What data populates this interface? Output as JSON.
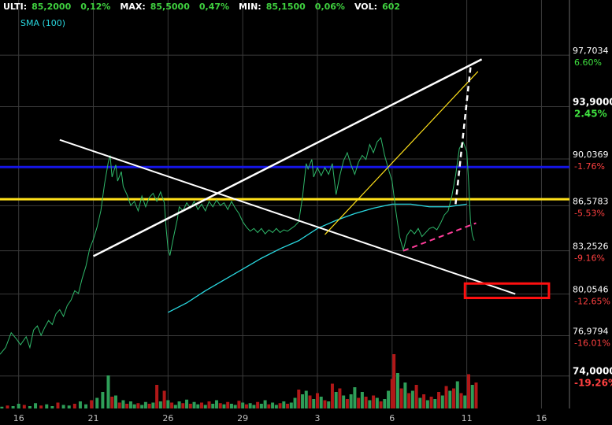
{
  "header": {
    "items": [
      {
        "label": "ULTI:",
        "value": "85,2000"
      },
      {
        "label": "",
        "value": "0,12%"
      },
      {
        "label": "MAX:",
        "value": "85,5000"
      },
      {
        "label": "",
        "value": "0,47%"
      },
      {
        "label": "MIN:",
        "value": "85,1500"
      },
      {
        "label": "",
        "value": "0,06%"
      },
      {
        "label": "VOL:",
        "value": "602"
      }
    ]
  },
  "legend": {
    "sma_label": "SMA (100)",
    "sma_color": "#29d8e0"
  },
  "colors": {
    "price_line": "#2fb86a",
    "sma": "#29d8e0",
    "blue_level": "#1515e6",
    "yellow_level": "#ffe11a",
    "trend_white": "#ffffff",
    "trend_yellow": "#ffe11a",
    "pink_dashed": "#ff3d9a",
    "box_red": "#ff1010",
    "vol_up": "#2e9e58",
    "vol_down": "#b01818",
    "grid": "#3a3a3a"
  },
  "chart_data": {
    "type": "line",
    "y_axis": {
      "range": [
        71.6,
        101.2
      ],
      "labels": [
        {
          "price": 97.7034,
          "text": "97,7034",
          "pct": "6.60%",
          "sign": "pos",
          "big": false
        },
        {
          "price": 93.9,
          "text": "93,9000",
          "pct": "2.45%",
          "sign": "pos",
          "big": true
        },
        {
          "price": 90.0369,
          "text": "90,0369",
          "pct": "-1.76%",
          "sign": "neg",
          "big": false
        },
        {
          "price": 86.5783,
          "text": "86,5783",
          "pct": "-5.53%",
          "sign": "neg",
          "big": false
        },
        {
          "price": 83.2526,
          "text": "83,2526",
          "pct": "-9.16%",
          "sign": "neg",
          "big": false
        },
        {
          "price": 80.0546,
          "text": "80,0546",
          "pct": "-12.65%",
          "sign": "neg",
          "big": false
        },
        {
          "price": 76.9794,
          "text": "76,9794",
          "pct": "-16.01%",
          "sign": "neg",
          "big": false
        },
        {
          "price": 74.0,
          "text": "74,0000",
          "pct": "-19.26%",
          "sign": "neg",
          "big": true
        }
      ]
    },
    "x_axis": {
      "ticks": [
        {
          "day": 1,
          "label": "16"
        },
        {
          "day": 5,
          "label": "21"
        },
        {
          "day": 9,
          "label": "26"
        },
        {
          "day": 13,
          "label": "29"
        },
        {
          "day": 17,
          "label": "3"
        },
        {
          "day": 21,
          "label": "6"
        },
        {
          "day": 25,
          "label": "11"
        },
        {
          "day": 29,
          "label": "16"
        }
      ],
      "range": [
        0,
        30.5
      ]
    },
    "price_series": [
      [
        0,
        75.6
      ],
      [
        0.3,
        76.1
      ],
      [
        0.6,
        77.2
      ],
      [
        0.9,
        76.7
      ],
      [
        1.1,
        76.3
      ],
      [
        1.4,
        76.9
      ],
      [
        1.6,
        76.1
      ],
      [
        1.8,
        77.4
      ],
      [
        2.0,
        77.7
      ],
      [
        2.2,
        77.0
      ],
      [
        2.4,
        77.6
      ],
      [
        2.6,
        78.1
      ],
      [
        2.8,
        77.8
      ],
      [
        3.0,
        78.6
      ],
      [
        3.2,
        78.9
      ],
      [
        3.4,
        78.4
      ],
      [
        3.6,
        79.2
      ],
      [
        3.8,
        79.6
      ],
      [
        4.0,
        80.3
      ],
      [
        4.2,
        80.1
      ],
      [
        4.4,
        81.2
      ],
      [
        4.6,
        82.1
      ],
      [
        4.8,
        83.4
      ],
      [
        5.0,
        84.1
      ],
      [
        5.2,
        85.0
      ],
      [
        5.4,
        86.2
      ],
      [
        5.6,
        88.2
      ],
      [
        5.8,
        89.8
      ],
      [
        5.9,
        90.3
      ],
      [
        6.0,
        88.7
      ],
      [
        6.2,
        89.6
      ],
      [
        6.3,
        88.4
      ],
      [
        6.5,
        89.1
      ],
      [
        6.6,
        88.0
      ],
      [
        6.8,
        87.4
      ],
      [
        7.0,
        86.6
      ],
      [
        7.2,
        86.9
      ],
      [
        7.4,
        86.2
      ],
      [
        7.6,
        87.3
      ],
      [
        7.8,
        86.5
      ],
      [
        8.0,
        87.2
      ],
      [
        8.2,
        87.5
      ],
      [
        8.4,
        86.9
      ],
      [
        8.6,
        87.6
      ],
      [
        8.8,
        86.8
      ],
      [
        8.9,
        84.9
      ],
      [
        9.0,
        83.4
      ],
      [
        9.1,
        82.9
      ],
      [
        9.3,
        84.3
      ],
      [
        9.5,
        85.6
      ],
      [
        9.6,
        86.5
      ],
      [
        9.8,
        86.2
      ],
      [
        10.0,
        86.8
      ],
      [
        10.2,
        86.4
      ],
      [
        10.4,
        86.9
      ],
      [
        10.6,
        86.3
      ],
      [
        10.8,
        86.7
      ],
      [
        11.0,
        86.2
      ],
      [
        11.2,
        86.9
      ],
      [
        11.4,
        86.5
      ],
      [
        11.6,
        87.0
      ],
      [
        11.8,
        86.6
      ],
      [
        12.0,
        86.8
      ],
      [
        12.2,
        86.3
      ],
      [
        12.4,
        86.9
      ],
      [
        12.6,
        86.4
      ],
      [
        12.8,
        86.0
      ],
      [
        13.0,
        85.4
      ],
      [
        13.2,
        85.0
      ],
      [
        13.4,
        84.7
      ],
      [
        13.6,
        84.9
      ],
      [
        13.8,
        84.6
      ],
      [
        14.0,
        84.9
      ],
      [
        14.2,
        84.5
      ],
      [
        14.4,
        84.8
      ],
      [
        14.6,
        84.6
      ],
      [
        14.8,
        84.9
      ],
      [
        15.0,
        84.6
      ],
      [
        15.2,
        84.8
      ],
      [
        15.4,
        84.7
      ],
      [
        15.6,
        84.9
      ],
      [
        15.8,
        85.1
      ],
      [
        16.0,
        85.4
      ],
      [
        16.2,
        87.2
      ],
      [
        16.4,
        89.7
      ],
      [
        16.5,
        89.3
      ],
      [
        16.7,
        90.0
      ],
      [
        16.8,
        88.7
      ],
      [
        17.0,
        89.4
      ],
      [
        17.2,
        88.8
      ],
      [
        17.4,
        89.4
      ],
      [
        17.6,
        88.9
      ],
      [
        17.8,
        89.7
      ],
      [
        18.0,
        87.4
      ],
      [
        18.2,
        88.8
      ],
      [
        18.4,
        89.9
      ],
      [
        18.6,
        90.5
      ],
      [
        18.8,
        89.6
      ],
      [
        19.0,
        88.9
      ],
      [
        19.2,
        89.8
      ],
      [
        19.4,
        90.3
      ],
      [
        19.6,
        90.0
      ],
      [
        19.8,
        91.1
      ],
      [
        20.0,
        90.5
      ],
      [
        20.2,
        91.3
      ],
      [
        20.4,
        91.6
      ],
      [
        20.6,
        90.3
      ],
      [
        20.8,
        89.3
      ],
      [
        21.0,
        88.4
      ],
      [
        21.2,
        86.2
      ],
      [
        21.4,
        84.3
      ],
      [
        21.6,
        83.3
      ],
      [
        21.8,
        84.4
      ],
      [
        22.0,
        84.8
      ],
      [
        22.2,
        84.5
      ],
      [
        22.4,
        84.9
      ],
      [
        22.6,
        84.3
      ],
      [
        22.8,
        84.6
      ],
      [
        23.0,
        84.9
      ],
      [
        23.2,
        85.0
      ],
      [
        23.4,
        84.8
      ],
      [
        23.6,
        85.3
      ],
      [
        23.8,
        85.9
      ],
      [
        24.0,
        86.2
      ],
      [
        24.2,
        87.3
      ],
      [
        24.4,
        88.8
      ],
      [
        24.6,
        90.8
      ],
      [
        24.8,
        91.3
      ],
      [
        25.0,
        90.6
      ],
      [
        25.1,
        88.3
      ],
      [
        25.2,
        85.4
      ],
      [
        25.3,
        84.4
      ],
      [
        25.4,
        84.0
      ]
    ],
    "sma_series": [
      [
        9.0,
        78.7
      ],
      [
        10.0,
        79.4
      ],
      [
        11.0,
        80.3
      ],
      [
        12.0,
        81.1
      ],
      [
        13.0,
        81.9
      ],
      [
        14.0,
        82.7
      ],
      [
        15.0,
        83.4
      ],
      [
        16.0,
        84.0
      ],
      [
        17.0,
        84.9
      ],
      [
        18.0,
        85.5
      ],
      [
        19.0,
        86.0
      ],
      [
        20.0,
        86.4
      ],
      [
        21.0,
        86.7
      ],
      [
        22.0,
        86.7
      ],
      [
        23.0,
        86.5
      ],
      [
        24.0,
        86.5
      ],
      [
        25.0,
        86.7
      ]
    ],
    "volume": [
      [
        0.1,
        3,
        "up"
      ],
      [
        0.4,
        5,
        "down"
      ],
      [
        0.7,
        4,
        "up"
      ],
      [
        1.0,
        8,
        "up"
      ],
      [
        1.3,
        6,
        "down"
      ],
      [
        1.6,
        4,
        "up"
      ],
      [
        1.9,
        9,
        "up"
      ],
      [
        2.2,
        5,
        "down"
      ],
      [
        2.5,
        7,
        "up"
      ],
      [
        2.8,
        4,
        "up"
      ],
      [
        3.1,
        10,
        "down"
      ],
      [
        3.4,
        6,
        "up"
      ],
      [
        3.7,
        5,
        "up"
      ],
      [
        4.0,
        8,
        "down"
      ],
      [
        4.3,
        12,
        "up"
      ],
      [
        4.6,
        7,
        "up"
      ],
      [
        4.9,
        14,
        "down"
      ],
      [
        5.2,
        18,
        "up"
      ],
      [
        5.5,
        28,
        "up"
      ],
      [
        5.8,
        56,
        "up"
      ],
      [
        6.0,
        20,
        "down"
      ],
      [
        6.2,
        22,
        "up"
      ],
      [
        6.4,
        10,
        "down"
      ],
      [
        6.6,
        14,
        "up"
      ],
      [
        6.8,
        8,
        "down"
      ],
      [
        7.0,
        12,
        "up"
      ],
      [
        7.2,
        7,
        "up"
      ],
      [
        7.4,
        9,
        "down"
      ],
      [
        7.6,
        6,
        "up"
      ],
      [
        7.8,
        11,
        "up"
      ],
      [
        8.0,
        8,
        "down"
      ],
      [
        8.2,
        10,
        "up"
      ],
      [
        8.4,
        40,
        "down"
      ],
      [
        8.6,
        12,
        "up"
      ],
      [
        8.8,
        30,
        "down"
      ],
      [
        9.0,
        14,
        "up"
      ],
      [
        9.2,
        10,
        "down"
      ],
      [
        9.4,
        6,
        "up"
      ],
      [
        9.6,
        12,
        "up"
      ],
      [
        9.8,
        9,
        "down"
      ],
      [
        10.0,
        15,
        "up"
      ],
      [
        10.2,
        8,
        "down"
      ],
      [
        10.4,
        11,
        "up"
      ],
      [
        10.6,
        7,
        "up"
      ],
      [
        10.8,
        10,
        "down"
      ],
      [
        11.0,
        6,
        "up"
      ],
      [
        11.2,
        12,
        "down"
      ],
      [
        11.4,
        8,
        "up"
      ],
      [
        11.6,
        14,
        "up"
      ],
      [
        11.8,
        9,
        "down"
      ],
      [
        12.0,
        7,
        "up"
      ],
      [
        12.2,
        11,
        "down"
      ],
      [
        12.4,
        8,
        "up"
      ],
      [
        12.6,
        6,
        "up"
      ],
      [
        12.8,
        13,
        "down"
      ],
      [
        13.0,
        10,
        "up"
      ],
      [
        13.2,
        7,
        "down"
      ],
      [
        13.4,
        9,
        "up"
      ],
      [
        13.6,
        6,
        "up"
      ],
      [
        13.8,
        11,
        "down"
      ],
      [
        14.0,
        8,
        "up"
      ],
      [
        14.2,
        14,
        "up"
      ],
      [
        14.4,
        7,
        "down"
      ],
      [
        14.6,
        10,
        "up"
      ],
      [
        14.8,
        6,
        "up"
      ],
      [
        15.0,
        9,
        "down"
      ],
      [
        15.2,
        12,
        "up"
      ],
      [
        15.4,
        8,
        "down"
      ],
      [
        15.6,
        10,
        "up"
      ],
      [
        15.8,
        18,
        "up"
      ],
      [
        16.0,
        32,
        "down"
      ],
      [
        16.2,
        24,
        "up"
      ],
      [
        16.4,
        30,
        "up"
      ],
      [
        16.6,
        22,
        "down"
      ],
      [
        16.8,
        16,
        "up"
      ],
      [
        17.0,
        26,
        "down"
      ],
      [
        17.2,
        20,
        "up"
      ],
      [
        17.4,
        14,
        "down"
      ],
      [
        17.6,
        12,
        "up"
      ],
      [
        17.8,
        42,
        "down"
      ],
      [
        18.0,
        28,
        "up"
      ],
      [
        18.2,
        34,
        "down"
      ],
      [
        18.4,
        22,
        "up"
      ],
      [
        18.6,
        16,
        "down"
      ],
      [
        18.8,
        24,
        "up"
      ],
      [
        19.0,
        36,
        "up"
      ],
      [
        19.2,
        18,
        "down"
      ],
      [
        19.4,
        28,
        "up"
      ],
      [
        19.6,
        20,
        "down"
      ],
      [
        19.8,
        14,
        "up"
      ],
      [
        20.0,
        22,
        "down"
      ],
      [
        20.2,
        18,
        "up"
      ],
      [
        20.4,
        12,
        "down"
      ],
      [
        20.6,
        16,
        "up"
      ],
      [
        20.8,
        30,
        "up"
      ],
      [
        21.0,
        50,
        "down"
      ],
      [
        21.1,
        92,
        "down"
      ],
      [
        21.3,
        60,
        "up"
      ],
      [
        21.5,
        34,
        "down"
      ],
      [
        21.7,
        44,
        "up"
      ],
      [
        21.9,
        26,
        "down"
      ],
      [
        22.1,
        30,
        "up"
      ],
      [
        22.3,
        40,
        "down"
      ],
      [
        22.5,
        18,
        "up"
      ],
      [
        22.7,
        24,
        "down"
      ],
      [
        22.9,
        14,
        "up"
      ],
      [
        23.1,
        20,
        "down"
      ],
      [
        23.3,
        16,
        "up"
      ],
      [
        23.5,
        28,
        "down"
      ],
      [
        23.7,
        22,
        "up"
      ],
      [
        23.9,
        38,
        "down"
      ],
      [
        24.1,
        30,
        "up"
      ],
      [
        24.3,
        34,
        "down"
      ],
      [
        24.5,
        46,
        "up"
      ],
      [
        24.7,
        26,
        "down"
      ],
      [
        24.9,
        22,
        "up"
      ],
      [
        25.1,
        58,
        "down"
      ],
      [
        25.3,
        40,
        "up"
      ],
      [
        25.5,
        44,
        "down"
      ]
    ],
    "volume_max": 100,
    "levels": [
      {
        "price": 89.44,
        "color_key": "blue_level"
      },
      {
        "price": 87.06,
        "color_key": "yellow_level"
      }
    ],
    "trendlines": [
      {
        "from": [
          9.9,
          89.87
        ],
        "to": [
          14.6,
          89.87
        ],
        "color_key": "trend_white",
        "dashed": false,
        "width": 0
      },
      {
        "from": [
          3.2,
          91.45
        ],
        "to": [
          27.6,
          80.06
        ],
        "color_key": "trend_white",
        "dashed": false,
        "width": 2
      },
      {
        "from": [
          5.0,
          82.85
        ],
        "to": [
          25.8,
          97.4
        ],
        "color_key": "trend_white",
        "dashed": false,
        "width": 2.5
      },
      {
        "from": [
          17.4,
          84.45
        ],
        "to": [
          25.6,
          96.5
        ],
        "color_key": "trend_yellow",
        "dashed": false,
        "width": 1.2
      },
      {
        "from": [
          21.6,
          83.25
        ],
        "to": [
          25.5,
          85.3
        ],
        "color_key": "pink_dashed",
        "dashed": true,
        "width": 2
      },
      {
        "from": [
          24.4,
          86.7
        ],
        "to": [
          25.2,
          96.8
        ],
        "color_key": "trend_white",
        "dashed": true,
        "width": 2.5
      }
    ],
    "highlight_box": {
      "from": [
        24.9,
        80.6
      ],
      "to": [
        29.4,
        80.0
      ]
    }
  }
}
